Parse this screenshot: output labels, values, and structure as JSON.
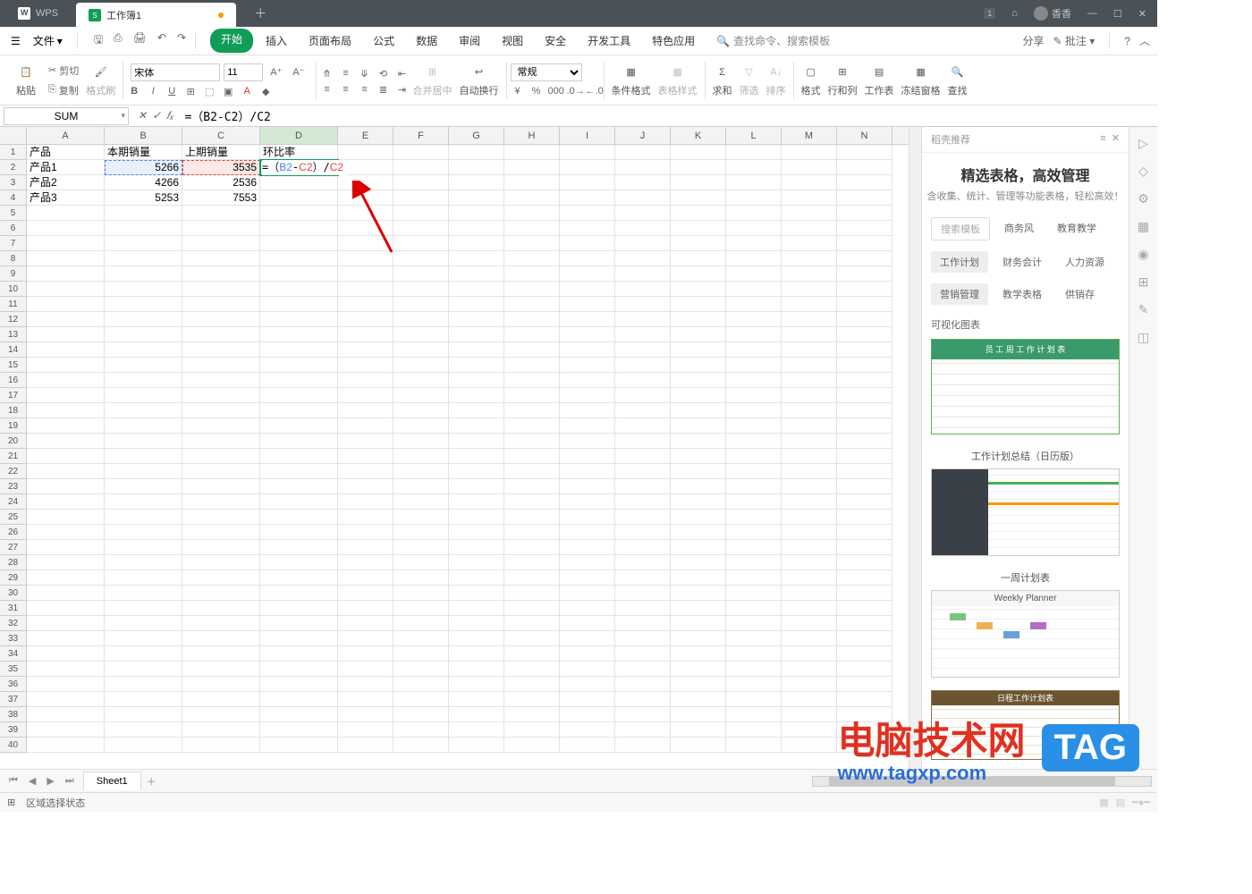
{
  "app": {
    "name": "WPS",
    "doc_title": "工作簿1",
    "user": "香香",
    "badge": "1"
  },
  "file_menu": "文件",
  "menu_tabs": [
    "开始",
    "插入",
    "页面布局",
    "公式",
    "数据",
    "审阅",
    "视图",
    "安全",
    "开发工具",
    "特色应用"
  ],
  "menu_active_index": 0,
  "search_placeholder": "查找命令、搜索模板",
  "right_menu": {
    "share": "分享",
    "annotate": "批注"
  },
  "ribbon": {
    "paste": "粘贴",
    "cut": "剪切",
    "copy": "复制",
    "format_painter": "格式刷",
    "font_name": "宋体",
    "font_size": "11",
    "merge_center": "合并居中",
    "auto_wrap": "自动换行",
    "number_format": "常规",
    "cond_fmt": "条件格式",
    "table_style": "表格样式",
    "sum": "求和",
    "filter": "筛选",
    "sort": "排序",
    "format": "格式",
    "rowcol": "行和列",
    "worksheet": "工作表",
    "freeze": "冻结窗格",
    "find": "查找"
  },
  "name_box": "SUM",
  "formula_bar": "=（B2-C2）/C2",
  "formula_tokens": {
    "eq": "=",
    "lp": "（",
    "b2": "B2",
    "minus": "-",
    "c2a": "C2",
    "rp": "）",
    "slash": "/",
    "c2b": "C2"
  },
  "columns": [
    "A",
    "B",
    "C",
    "D",
    "E",
    "F",
    "G",
    "H",
    "I",
    "J",
    "K",
    "L",
    "M",
    "N"
  ],
  "selected_col": "D",
  "sheet_data": {
    "headers": {
      "A": "产品",
      "B": "本期销量",
      "C": "上期销量",
      "D": "环比率"
    },
    "rows": [
      {
        "A": "产品1",
        "B": "5266",
        "C": "3535"
      },
      {
        "A": "产品2",
        "B": "4266",
        "C": "2536"
      },
      {
        "A": "产品3",
        "B": "5253",
        "C": "7553"
      }
    ]
  },
  "row_count": 40,
  "sheet_tab": "Sheet1",
  "status_text": "区域选择状态",
  "right_panel": {
    "header": "稻壳推荐",
    "title": "精选表格，高效管理",
    "subtitle": "含收集、统计、管理等功能表格，轻松高效！",
    "tag_search": "搜索模板",
    "tags_row1": [
      "商务风",
      "教育教学"
    ],
    "tags_row2": [
      "工作计划",
      "财务会计",
      "人力资源"
    ],
    "tags_row3": [
      "营销管理",
      "教学表格",
      "供销存"
    ],
    "section1": "可视化图表",
    "tmpl1_head": "员 工 周 工 作 计 划 表",
    "tmpl2_title": "工作计划总结（日历版）",
    "tmpl3_title": "一周计划表",
    "tmpl3_head": "Weekly Planner",
    "tmpl4_head": "日程工作计划表"
  },
  "watermark": {
    "title": "电脑技术网",
    "url": "www.tagxp.com",
    "tag": "TAG"
  }
}
